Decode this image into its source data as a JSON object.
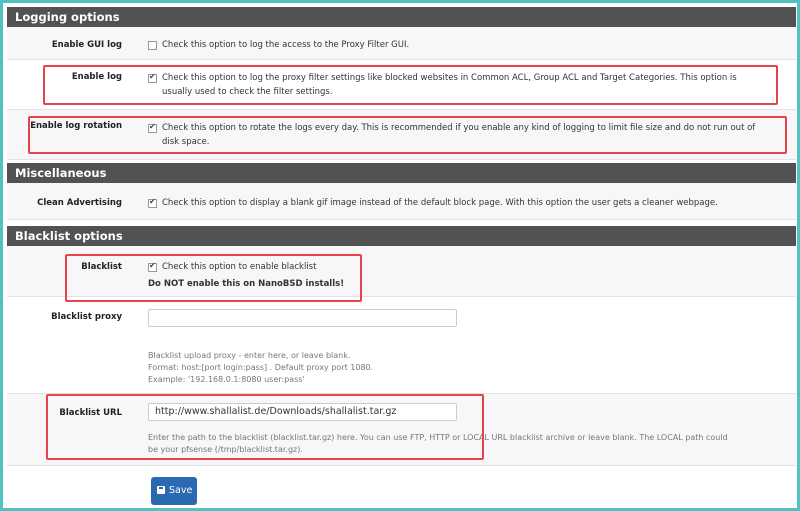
{
  "sections": {
    "logging": "Logging options",
    "misc": "Miscellaneous",
    "blacklist": "Blacklist options"
  },
  "rows": {
    "enable_gui_log": {
      "label": "Enable GUI log",
      "checked": false,
      "desc": "Check this option to log the access to the Proxy Filter GUI."
    },
    "enable_log": {
      "label": "Enable log",
      "checked": true,
      "desc1": "Check this option to log the proxy filter settings like blocked websites in Common ACL, Group ACL and Target Categories. This option is",
      "desc2": "usually used to check the filter settings."
    },
    "enable_log_rotation": {
      "label": "Enable log rotation",
      "checked": true,
      "desc1": "Check this option to rotate the logs every day. This is recommended if you enable any kind of logging to limit file size and do not run out of",
      "desc2": "disk space."
    },
    "clean_advertising": {
      "label": "Clean Advertising",
      "checked": true,
      "desc": "Check this option to display a blank gif image instead of the default block page. With this option the user gets a cleaner webpage."
    },
    "blacklist": {
      "label": "Blacklist",
      "checked": true,
      "desc": "Check this option to enable blacklist",
      "warning": "Do NOT enable this on NanoBSD installs!"
    },
    "blacklist_proxy": {
      "label": "Blacklist proxy",
      "value": "",
      "help1": "Blacklist upload proxy - enter here, or leave blank.",
      "help2": "Format: host:[port login:pass] . Default proxy port 1080.",
      "help3": "Example: '192.168.0.1:8080 user:pass'"
    },
    "blacklist_url": {
      "label": "Blacklist URL",
      "value": "http://www.shallalist.de/Downloads/shallalist.tar.gz",
      "help1": "Enter the path to the blacklist (blacklist.tar.gz) here. You can use FTP, HTTP or LOCAL URL blacklist archive or leave blank. The LOCAL path could",
      "help2": "be your pfsense (/tmp/blacklist.tar.gz)."
    }
  },
  "save_button": {
    "label": "Save",
    "icon": "floppy-disk-icon"
  },
  "colors": {
    "background": "#4fc3c2",
    "section_header": "#505254",
    "highlight": "#e8434b",
    "save_button": "#2a6ab0"
  }
}
